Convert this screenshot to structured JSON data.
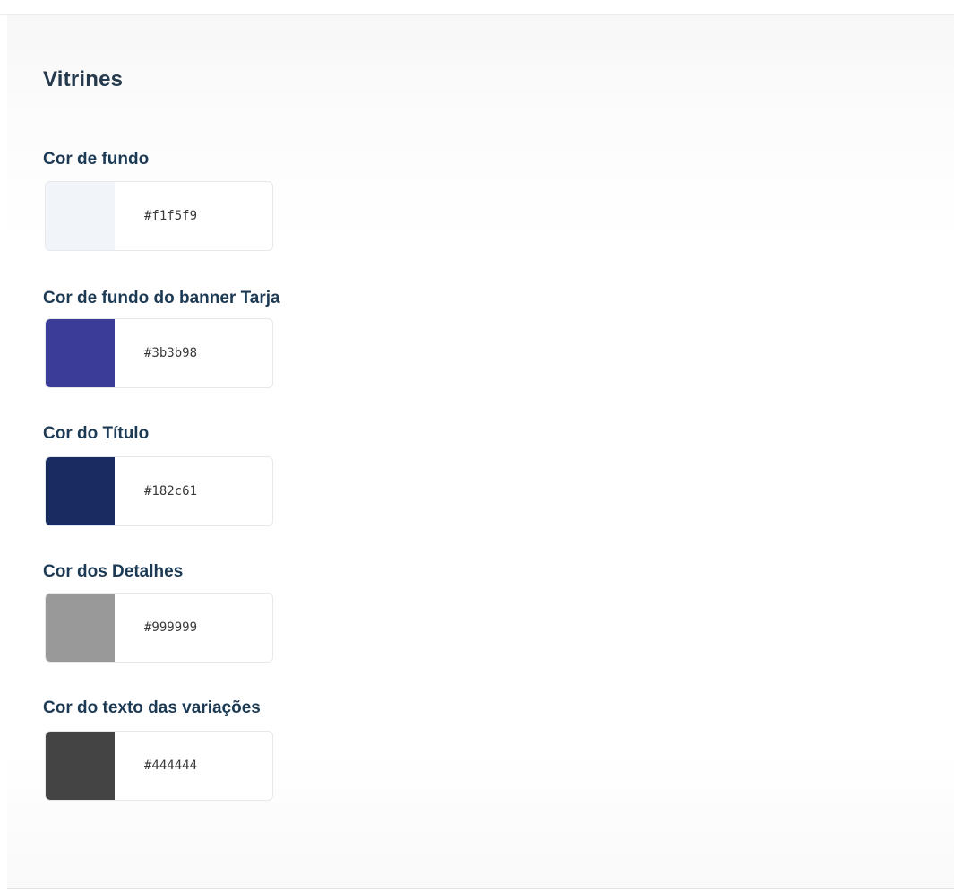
{
  "section": {
    "title": "Vitrines"
  },
  "fields": [
    {
      "label": "Cor de fundo",
      "value": "#f1f5f9",
      "color": "#f1f5f9"
    },
    {
      "label": "Cor de fundo do banner Tarja",
      "value": "#3b3b98",
      "color": "#3b3b98"
    },
    {
      "label": "Cor do Título",
      "value": "#182c61",
      "color": "#182c61"
    },
    {
      "label": "Cor dos Detalhes",
      "value": "#999999",
      "color": "#999999"
    },
    {
      "label": "Cor do texto das variações",
      "value": "#444444",
      "color": "#444444"
    }
  ]
}
